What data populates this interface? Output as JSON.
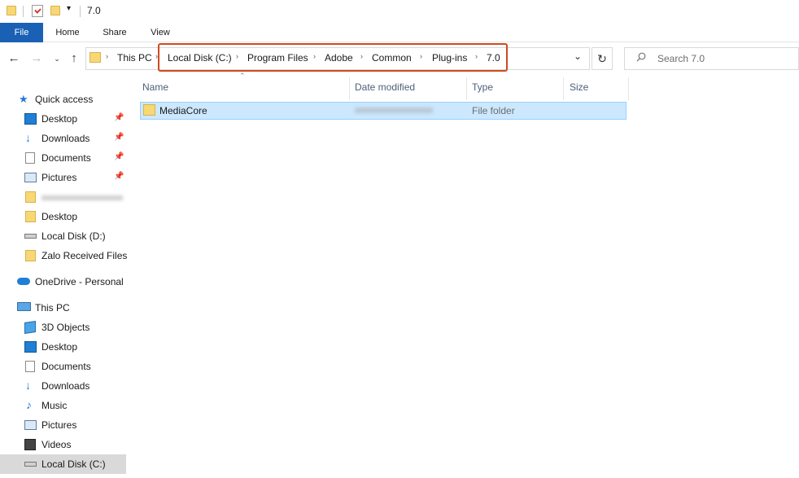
{
  "window": {
    "title": "7.0"
  },
  "ribbon": {
    "tabs": [
      "File",
      "Home",
      "Share",
      "View"
    ]
  },
  "address": {
    "crumbs": [
      "This PC",
      "Local Disk (C:)",
      "Program Files",
      "Adobe",
      "Common",
      "Plug-ins",
      "7.0"
    ]
  },
  "search": {
    "placeholder": "Search 7.0"
  },
  "sidebar": {
    "items": [
      {
        "label": "Quick access",
        "icon": "star-icon",
        "pinned": false
      },
      {
        "label": "Desktop",
        "icon": "desktop-icon",
        "pinned": true
      },
      {
        "label": "Downloads",
        "icon": "download-icon",
        "pinned": true
      },
      {
        "label": "Documents",
        "icon": "documents-icon",
        "pinned": true
      },
      {
        "label": "Pictures",
        "icon": "pictures-icon",
        "pinned": true
      },
      {
        "label": "",
        "icon": "folder-icon",
        "pinned": false
      },
      {
        "label": "Desktop",
        "icon": "folder-icon",
        "pinned": false
      },
      {
        "label": "Local Disk (D:)",
        "icon": "drive-icon",
        "pinned": false
      },
      {
        "label": "Zalo Received Files",
        "icon": "folder-icon",
        "pinned": false
      },
      {
        "label": "OneDrive - Personal",
        "icon": "cloud-icon",
        "pinned": false
      },
      {
        "label": "This PC",
        "icon": "computer-icon",
        "pinned": false
      },
      {
        "label": "3D Objects",
        "icon": "cube-icon",
        "pinned": false
      },
      {
        "label": "Desktop",
        "icon": "desktop-icon",
        "pinned": false
      },
      {
        "label": "Documents",
        "icon": "documents-icon",
        "pinned": false
      },
      {
        "label": "Downloads",
        "icon": "download-icon",
        "pinned": false
      },
      {
        "label": "Music",
        "icon": "music-icon",
        "pinned": false
      },
      {
        "label": "Pictures",
        "icon": "pictures-icon",
        "pinned": false
      },
      {
        "label": "Videos",
        "icon": "video-icon",
        "pinned": false
      },
      {
        "label": "Local Disk (C:)",
        "icon": "drive-icon",
        "pinned": false,
        "selected": true
      }
    ]
  },
  "columns": {
    "name": "Name",
    "date": "Date modified",
    "type": "Type",
    "size": "Size"
  },
  "files": [
    {
      "name": "MediaCore",
      "date_modified": "",
      "type": "File folder",
      "size": ""
    }
  ],
  "colors": {
    "accent": "#1a61b5",
    "selection": "#cce8ff",
    "annotation": "#cf4a1f",
    "folder": "#f8d775"
  }
}
